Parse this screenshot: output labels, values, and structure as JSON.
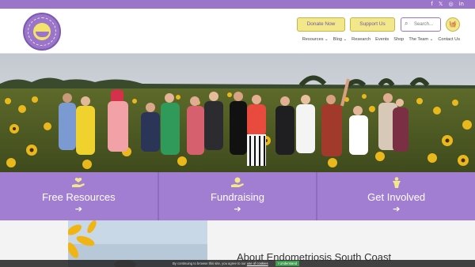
{
  "social": {
    "facebook": "f",
    "twitter": "𝕏",
    "instagram": "◎",
    "linkedin": "in"
  },
  "header": {
    "donate_label": "Donate Now",
    "support_label": "Support Us",
    "search_placeholder": "Search...",
    "nav": [
      "Resources ⌄",
      "Blog ⌄",
      "Research",
      "Events",
      "Shop",
      "The Team ⌄",
      "Contact Us"
    ]
  },
  "bands": [
    {
      "title": "Free Resources",
      "arrow": "➔"
    },
    {
      "title": "Fundraising",
      "arrow": "➔"
    },
    {
      "title": "Get Involved",
      "arrow": "➔"
    }
  ],
  "about": {
    "title": "About Endometriosis South Coast"
  },
  "cookie": {
    "text_before": "By continuing to browse this site, you agree to our",
    "link": "use of cookies",
    "button": "I Understand"
  },
  "colors": {
    "brand_purple": "#9a75c9",
    "band_purple": "#a17ed1",
    "button_yellow": "#f3e78c",
    "cookie_green": "#3d9a4c"
  }
}
